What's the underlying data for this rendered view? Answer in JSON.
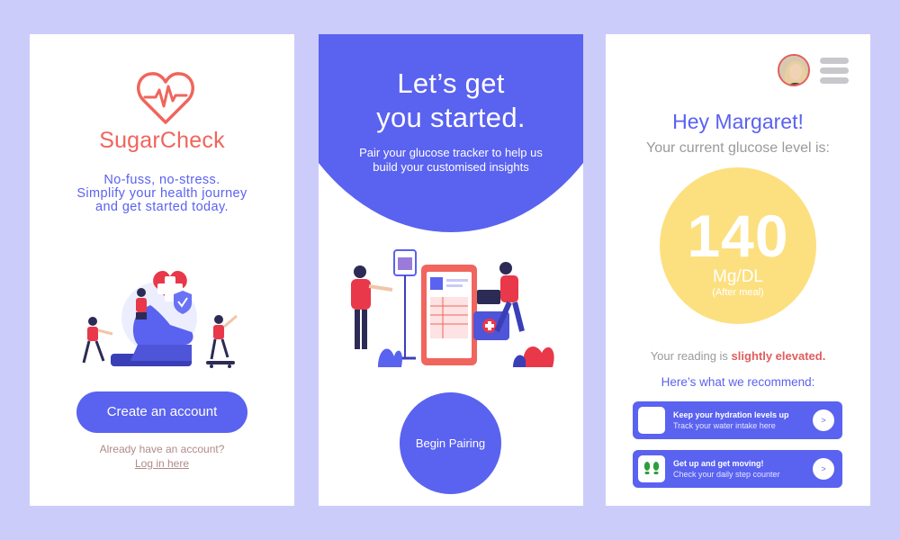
{
  "screen1": {
    "brand": "SugarCheck",
    "tagline": [
      "No-fuss, no-stress.",
      "Simplify your health journey",
      "and get started today."
    ],
    "create_account_label": "Create an account",
    "already_text": "Already have an account?",
    "login_link": "Log in here"
  },
  "screen2": {
    "title": [
      "Let’s get",
      "you started."
    ],
    "subtitle": [
      "Pair your glucose tracker to help us",
      "build your customised insights"
    ],
    "begin_pairing_label": "Begin Pairing"
  },
  "screen3": {
    "greeting": "Hey Margaret!",
    "current_label": "Your current glucose level is:",
    "glucose": {
      "value": "140",
      "unit": "Mg/DL",
      "context": "(After meal)"
    },
    "reading_prefix": "Your reading is ",
    "reading_status": "slightly elevated.",
    "recommend_title": "Here’s what we recommend:",
    "tips": [
      {
        "title": "Keep your hydration levels up",
        "desc": "Track your water intake here",
        "icon": "water-icon",
        "button": ">"
      },
      {
        "title": "Get up and get moving!",
        "desc": "Check your daily step counter",
        "icon": "footsteps-icon",
        "button": ">"
      }
    ]
  },
  "colors": {
    "background": "#ccccfb",
    "primary": "#5a62f0",
    "brand_red": "#f0655d",
    "gauge_yellow": "#fce07f",
    "alert_red": "#e05d5d"
  }
}
